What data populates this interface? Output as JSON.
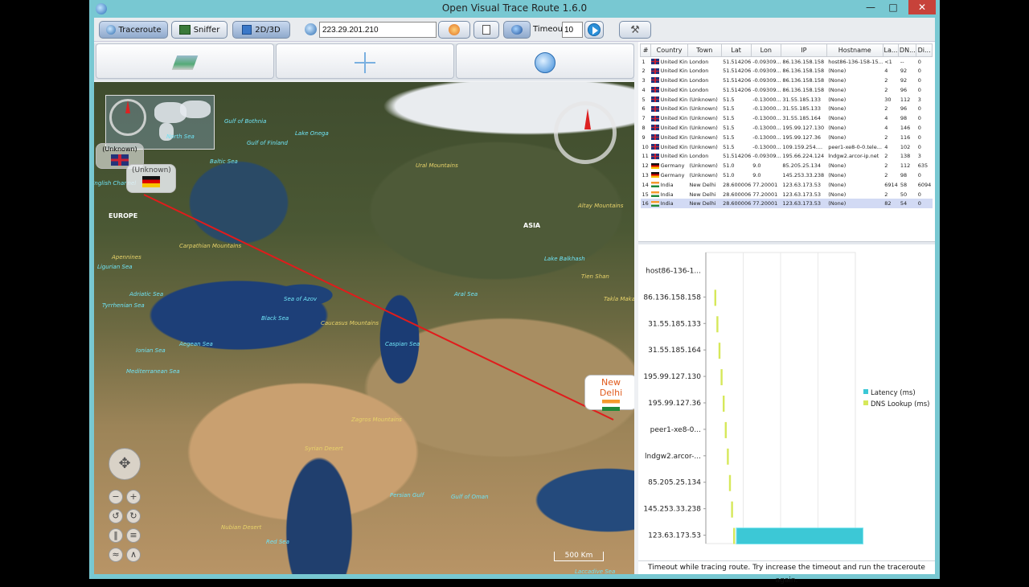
{
  "window": {
    "title": "Open Visual Trace Route 1.6.0"
  },
  "toolbar": {
    "traceroute_label": "Traceroute",
    "sniffer_label": "Sniffer",
    "view_toggle_label": "2D/3D",
    "ip_value": "223.29.201.210",
    "timeout_label": "Timeout",
    "timeout_value": "10"
  },
  "map": {
    "labels": [
      {
        "text": "Gulf of Bothnia",
        "kind": "sea"
      },
      {
        "text": "Lake Onega",
        "kind": "sea"
      },
      {
        "text": "Gulf of Finland",
        "kind": "sea"
      },
      {
        "text": "North Sea",
        "kind": "sea"
      },
      {
        "text": "Baltic Sea",
        "kind": "sea"
      },
      {
        "text": "Ural Mountains",
        "kind": "land"
      },
      {
        "text": "EUROPE",
        "kind": "cont"
      },
      {
        "text": "ASIA",
        "kind": "cont"
      },
      {
        "text": "Carpathian Mountains",
        "kind": "land"
      },
      {
        "text": "Apennines",
        "kind": "land"
      },
      {
        "text": "Ligurian Sea",
        "kind": "sea"
      },
      {
        "text": "Adriatic Sea",
        "kind": "sea"
      },
      {
        "text": "Tyrrhenian Sea",
        "kind": "sea"
      },
      {
        "text": "Ionian Sea",
        "kind": "sea"
      },
      {
        "text": "Aegean Sea",
        "kind": "sea"
      },
      {
        "text": "Mediterranean Sea",
        "kind": "sea"
      },
      {
        "text": "Black Sea",
        "kind": "sea"
      },
      {
        "text": "Sea of Azov",
        "kind": "sea"
      },
      {
        "text": "Caucasus Mountains",
        "kind": "land"
      },
      {
        "text": "Caspian Sea",
        "kind": "sea"
      },
      {
        "text": "Aral Sea",
        "kind": "sea"
      },
      {
        "text": "Lake Balkhash",
        "kind": "sea"
      },
      {
        "text": "Altay Mountains",
        "kind": "land"
      },
      {
        "text": "Tien Shan",
        "kind": "land"
      },
      {
        "text": "Takla Makan",
        "kind": "land"
      },
      {
        "text": "Zagros Mountains",
        "kind": "land"
      },
      {
        "text": "Syrian Desert",
        "kind": "land"
      },
      {
        "text": "Persian Gulf",
        "kind": "sea"
      },
      {
        "text": "Gulf of Oman",
        "kind": "sea"
      },
      {
        "text": "Nubian Desert",
        "kind": "land"
      },
      {
        "text": "Red Sea",
        "kind": "sea"
      },
      {
        "text": "Laccadive Sea",
        "kind": "sea"
      },
      {
        "text": "English Channel",
        "kind": "sea"
      }
    ],
    "balloon_unknown_uk": "(Unknown)",
    "balloon_unknown_de": "(Unknown)",
    "balloon_new_delhi": "New Delhi",
    "scale_label": "500 Km"
  },
  "hops": {
    "columns": [
      "#",
      "",
      "Country",
      "Town",
      "Lat",
      "Lon",
      "IP",
      "Hostname",
      "La...",
      "DN...",
      "Di..."
    ],
    "rows": [
      {
        "n": "1",
        "flag": "uk",
        "country": "United Kin...",
        "town": "London",
        "lat": "51.514206",
        "lon": "-0.09309...",
        "ip": "86.136.158.158",
        "host": "host86-136-158-15...",
        "lat_ms": "<1",
        "dns": "--",
        "dist": "0"
      },
      {
        "n": "2",
        "flag": "uk",
        "country": "United Kin...",
        "town": "London",
        "lat": "51.514206",
        "lon": "-0.09309...",
        "ip": "86.136.158.158",
        "host": "(None)",
        "lat_ms": "4",
        "dns": "92",
        "dist": "0"
      },
      {
        "n": "3",
        "flag": "uk",
        "country": "United Kin...",
        "town": "London",
        "lat": "51.514206",
        "lon": "-0.09309...",
        "ip": "86.136.158.158",
        "host": "(None)",
        "lat_ms": "2",
        "dns": "92",
        "dist": "0"
      },
      {
        "n": "4",
        "flag": "uk",
        "country": "United Kin...",
        "town": "London",
        "lat": "51.514206",
        "lon": "-0.09309...",
        "ip": "86.136.158.158",
        "host": "(None)",
        "lat_ms": "2",
        "dns": "96",
        "dist": "0"
      },
      {
        "n": "5",
        "flag": "uk",
        "country": "United Kin...",
        "town": "(Unknown)",
        "lat": "51.5",
        "lon": "-0.13000...",
        "ip": "31.55.185.133",
        "host": "(None)",
        "lat_ms": "30",
        "dns": "112",
        "dist": "3"
      },
      {
        "n": "6",
        "flag": "uk",
        "country": "United Kin...",
        "town": "(Unknown)",
        "lat": "51.5",
        "lon": "-0.13000...",
        "ip": "31.55.185.133",
        "host": "(None)",
        "lat_ms": "2",
        "dns": "96",
        "dist": "0"
      },
      {
        "n": "7",
        "flag": "uk",
        "country": "United Kin...",
        "town": "(Unknown)",
        "lat": "51.5",
        "lon": "-0.13000...",
        "ip": "31.55.185.164",
        "host": "(None)",
        "lat_ms": "4",
        "dns": "98",
        "dist": "0"
      },
      {
        "n": "8",
        "flag": "uk",
        "country": "United Kin...",
        "town": "(Unknown)",
        "lat": "51.5",
        "lon": "-0.13000...",
        "ip": "195.99.127.130",
        "host": "(None)",
        "lat_ms": "4",
        "dns": "146",
        "dist": "0"
      },
      {
        "n": "9",
        "flag": "uk",
        "country": "United Kin...",
        "town": "(Unknown)",
        "lat": "51.5",
        "lon": "-0.13000...",
        "ip": "195.99.127.36",
        "host": "(None)",
        "lat_ms": "2",
        "dns": "116",
        "dist": "0"
      },
      {
        "n": "10",
        "flag": "uk",
        "country": "United Kin...",
        "town": "(Unknown)",
        "lat": "51.5",
        "lon": "-0.13000...",
        "ip": "109.159.254....",
        "host": "peer1-xe8-0-0.tele...",
        "lat_ms": "4",
        "dns": "102",
        "dist": "0"
      },
      {
        "n": "11",
        "flag": "uk",
        "country": "United Kin...",
        "town": "London",
        "lat": "51.514206",
        "lon": "-0.09309...",
        "ip": "195.66.224.124",
        "host": "lndgw2.arcor-ip.net",
        "lat_ms": "2",
        "dns": "138",
        "dist": "3"
      },
      {
        "n": "12",
        "flag": "de",
        "country": "Germany",
        "town": "(Unknown)",
        "lat": "51.0",
        "lon": "9.0",
        "ip": "85.205.25.134",
        "host": "(None)",
        "lat_ms": "2",
        "dns": "112",
        "dist": "635"
      },
      {
        "n": "13",
        "flag": "de",
        "country": "Germany",
        "town": "(Unknown)",
        "lat": "51.0",
        "lon": "9.0",
        "ip": "145.253.33.238",
        "host": "(None)",
        "lat_ms": "2",
        "dns": "98",
        "dist": "0"
      },
      {
        "n": "14",
        "flag": "in",
        "country": "India",
        "town": "New Delhi",
        "lat": "28.600006",
        "lon": "77.20001",
        "ip": "123.63.173.53",
        "host": "(None)",
        "lat_ms": "6914",
        "dns": "58",
        "dist": "6094"
      },
      {
        "n": "15",
        "flag": "in",
        "country": "India",
        "town": "New Delhi",
        "lat": "28.600006",
        "lon": "77.20001",
        "ip": "123.63.173.53",
        "host": "(None)",
        "lat_ms": "2",
        "dns": "50",
        "dist": "0"
      },
      {
        "n": "16",
        "flag": "in",
        "country": "India",
        "town": "New Delhi",
        "lat": "28.600006",
        "lon": "77.20001",
        "ip": "123.63.173.53",
        "host": "(None)",
        "lat_ms": "82",
        "dns": "54",
        "dist": "0"
      }
    ]
  },
  "chart_data": {
    "type": "bar",
    "orientation": "horizontal-stacked",
    "categories": [
      "host86-136-1...",
      "86.136.158.158",
      "31.55.185.133",
      "31.55.185.164",
      "195.99.127.130",
      "195.99.127.36",
      "peer1-xe8-0...",
      "lndgw2.arcor-...",
      "85.205.25.134",
      "145.253.33.238",
      "123.63.173.53"
    ],
    "series": [
      {
        "name": "Latency (ms)",
        "color": "#3cc8d6",
        "values": [
          0,
          0,
          0,
          0,
          0,
          0,
          0,
          0,
          0,
          0,
          6914
        ]
      },
      {
        "name": "DNS Lookup (ms)",
        "color": "#d6e85a",
        "values": [
          0,
          92,
          112,
          98,
          146,
          116,
          102,
          138,
          112,
          98,
          58
        ]
      }
    ],
    "legend": "right",
    "grid": true
  },
  "status": {
    "message": "Timeout while tracing route. Try increase the timeout and run the traceroute again."
  }
}
